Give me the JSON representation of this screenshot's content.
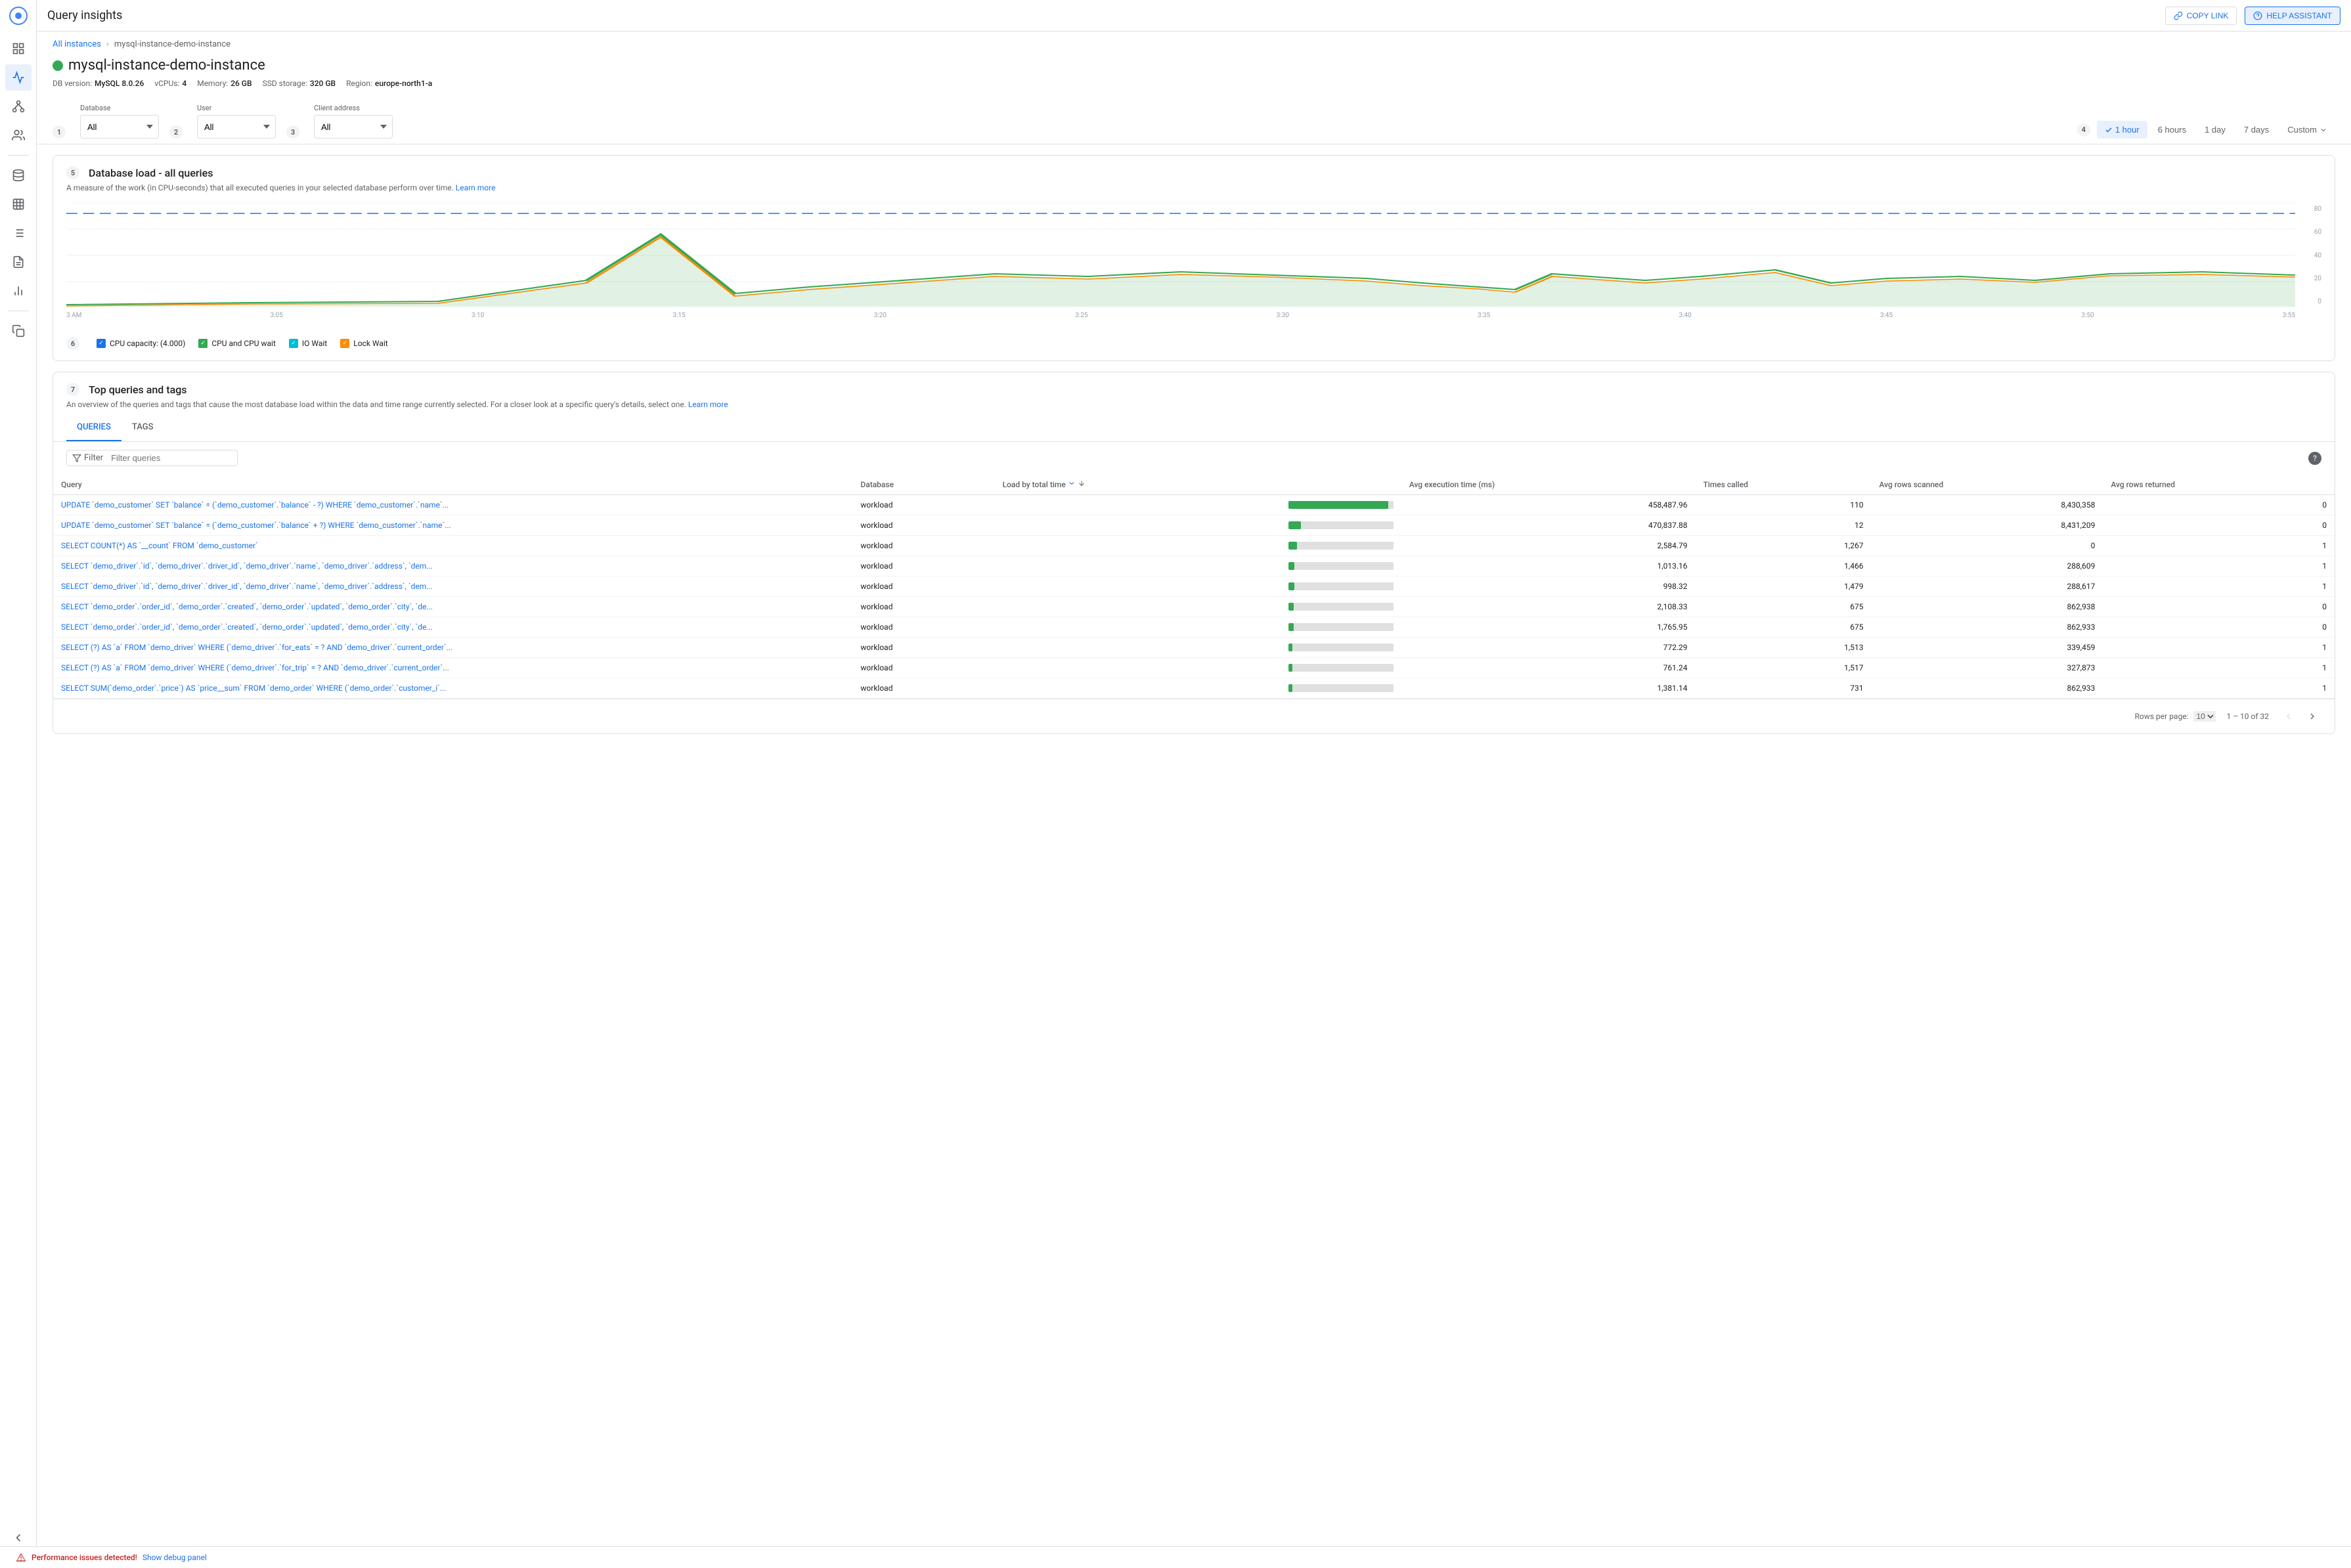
{
  "app": {
    "title": "Query insights"
  },
  "header": {
    "copy_link_label": "COPY LINK",
    "help_label": "HELP ASSISTANT"
  },
  "breadcrumb": {
    "all_instances": "All instances",
    "separator": "›",
    "instance": "mysql-instance-demo-instance"
  },
  "instance": {
    "name": "mysql-instance-demo-instance",
    "db_version_label": "DB version:",
    "db_version": "MySQL 8.0.26",
    "vcpus_label": "vCPUs:",
    "vcpus": "4",
    "memory_label": "Memory:",
    "memory": "26 GB",
    "ssd_label": "SSD storage:",
    "ssd": "320 GB",
    "region_label": "Region:",
    "region": "europe-north1-a"
  },
  "filters": {
    "step1": "1",
    "step2": "2",
    "step3": "3",
    "step4": "4",
    "database_label": "Database",
    "database_value": "All",
    "user_label": "User",
    "user_value": "All",
    "client_address_label": "Client address",
    "client_address_value": "All",
    "time_options": [
      "1 hour",
      "6 hours",
      "1 day",
      "7 days",
      "Custom"
    ],
    "active_time": "1 hour"
  },
  "chart_section": {
    "step": "5",
    "title": "Database load - all queries",
    "description": "A measure of the work (in CPU-seconds) that all executed queries in your selected database perform over time.",
    "learn_more": "Learn more",
    "y_axis": [
      "80",
      "60",
      "40",
      "20",
      "0"
    ],
    "x_axis": [
      "3 AM",
      "3:05",
      "3:10",
      "3:15",
      "3:20",
      "3:25",
      "3:30",
      "3:35",
      "3:40",
      "3:45",
      "3:50",
      "3:55"
    ],
    "step6": "6",
    "legend": [
      {
        "id": "cpu_capacity",
        "label": "CPU capacity: (4.000)",
        "color": "blue",
        "checked": true
      },
      {
        "id": "cpu_wait",
        "label": "CPU and CPU wait",
        "color": "green",
        "checked": true
      },
      {
        "id": "io_wait",
        "label": "IO Wait",
        "color": "teal",
        "checked": true
      },
      {
        "id": "lock_wait",
        "label": "Lock Wait",
        "color": "orange",
        "checked": true
      }
    ]
  },
  "queries_section": {
    "step": "7",
    "title": "Top queries and tags",
    "description": "An overview of the queries and tags that cause the most database load within the data and time range currently selected. For a closer look at a specific query's details, select one.",
    "learn_more": "Learn more",
    "tabs": [
      {
        "id": "queries",
        "label": "QUERIES",
        "active": true
      },
      {
        "id": "tags",
        "label": "TAGS",
        "active": false
      }
    ],
    "filter_label": "Filter",
    "filter_placeholder": "Filter queries",
    "table_columns": [
      "Query",
      "Database",
      "Load by total time ↓",
      "",
      "Avg execution time (ms)",
      "Times called",
      "Avg rows scanned",
      "Avg rows returned"
    ],
    "rows": [
      {
        "query": "UPDATE `demo_customer` SET `balance` = (`demo_customer`.`balance` - ?) WHERE `demo_customer`.`name`...",
        "database": "workload",
        "load_pct": 95,
        "avg_exec": "458,487.96",
        "times_called": "110",
        "avg_rows_scanned": "8,430,358",
        "avg_rows_returned": "0"
      },
      {
        "query": "UPDATE `demo_customer` SET `balance` = (`demo_customer`.`balance` + ?) WHERE `demo_customer`.`name`...",
        "database": "workload",
        "load_pct": 12,
        "avg_exec": "470,837.88",
        "times_called": "12",
        "avg_rows_scanned": "8,431,209",
        "avg_rows_returned": "0"
      },
      {
        "query": "SELECT COUNT(*) AS `__count` FROM `demo_customer`",
        "database": "workload",
        "load_pct": 8,
        "avg_exec": "2,584.79",
        "times_called": "1,267",
        "avg_rows_scanned": "0",
        "avg_rows_returned": "1"
      },
      {
        "query": "SELECT `demo_driver`.`id`, `demo_driver`.`driver_id`, `demo_driver`.`name`, `demo_driver`.`address`, `dem...",
        "database": "workload",
        "load_pct": 6,
        "avg_exec": "1,013.16",
        "times_called": "1,466",
        "avg_rows_scanned": "288,609",
        "avg_rows_returned": "1"
      },
      {
        "query": "SELECT `demo_driver`.`id`, `demo_driver`.`driver_id`, `demo_driver`.`name`, `demo_driver`.`address`, `dem...",
        "database": "workload",
        "load_pct": 6,
        "avg_exec": "998.32",
        "times_called": "1,479",
        "avg_rows_scanned": "288,617",
        "avg_rows_returned": "1"
      },
      {
        "query": "SELECT `demo_order`.`order_id`, `demo_order`.`created`, `demo_order`.`updated`, `demo_order`.`city`, `de...",
        "database": "workload",
        "load_pct": 5,
        "avg_exec": "2,108.33",
        "times_called": "675",
        "avg_rows_scanned": "862,938",
        "avg_rows_returned": "0"
      },
      {
        "query": "SELECT `demo_order`.`order_id`, `demo_order`.`created`, `demo_order`.`updated`, `demo_order`.`city`, `de...",
        "database": "workload",
        "load_pct": 5,
        "avg_exec": "1,765.95",
        "times_called": "675",
        "avg_rows_scanned": "862,933",
        "avg_rows_returned": "0"
      },
      {
        "query": "SELECT (?) AS `a` FROM `demo_driver` WHERE (`demo_driver`.`for_eats` = ? AND `demo_driver`.`current_order`...",
        "database": "workload",
        "load_pct": 4,
        "avg_exec": "772.29",
        "times_called": "1,513",
        "avg_rows_scanned": "339,459",
        "avg_rows_returned": "1"
      },
      {
        "query": "SELECT (?) AS `a` FROM `demo_driver` WHERE (`demo_driver`.`for_trip` = ? AND `demo_driver`.`current_order`...",
        "database": "workload",
        "load_pct": 4,
        "avg_exec": "761.24",
        "times_called": "1,517",
        "avg_rows_scanned": "327,873",
        "avg_rows_returned": "1"
      },
      {
        "query": "SELECT SUM(`demo_order`.`price`) AS `price__sum` FROM `demo_order` WHERE (`demo_order`.`customer_i`...",
        "database": "workload",
        "load_pct": 4,
        "avg_exec": "1,381.14",
        "times_called": "731",
        "avg_rows_scanned": "862,933",
        "avg_rows_returned": "1"
      }
    ],
    "pagination": {
      "rows_per_page_label": "Rows per page:",
      "rows_per_page": "10",
      "page_info": "1 – 10 of 32"
    }
  },
  "bottom_bar": {
    "perf_label": "Performance issues detected!",
    "debug_label": "Show debug panel"
  },
  "nav_items": [
    {
      "id": "menu",
      "icon": "☰"
    },
    {
      "id": "home",
      "icon": "⊞"
    },
    {
      "id": "chart",
      "icon": "📊"
    },
    {
      "id": "arrow",
      "icon": "→"
    },
    {
      "id": "people",
      "icon": "👥"
    },
    {
      "id": "storage",
      "icon": "🗄"
    },
    {
      "id": "grid",
      "icon": "⊟"
    },
    {
      "id": "list",
      "icon": "☰"
    },
    {
      "id": "report",
      "icon": "📋"
    },
    {
      "id": "settings",
      "icon": "⚙"
    }
  ]
}
